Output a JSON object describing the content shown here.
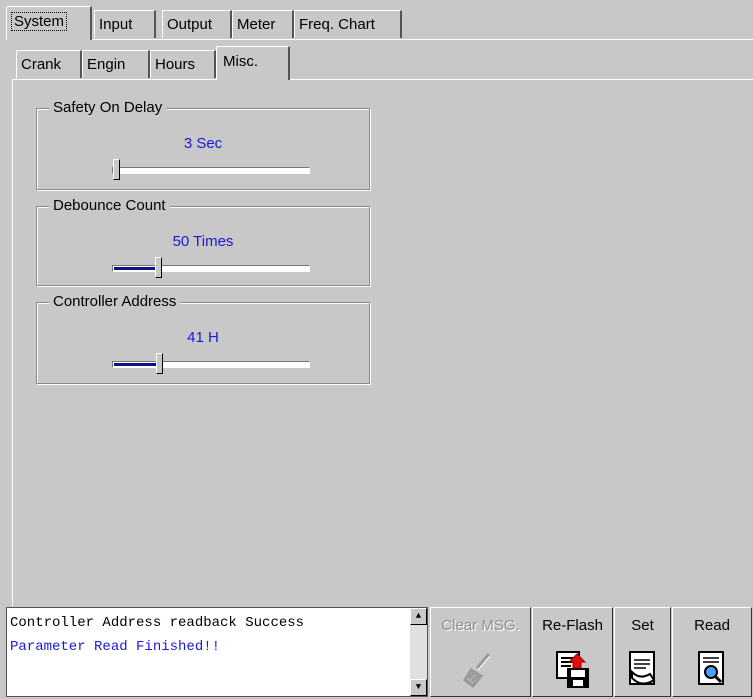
{
  "tabs_top": [
    {
      "label": "System"
    },
    {
      "label": "Input"
    },
    {
      "label": "Output"
    },
    {
      "label": "Meter"
    },
    {
      "label": "Freq. Chart"
    }
  ],
  "tabs_sub": [
    {
      "label": "Crank"
    },
    {
      "label": "Engin"
    },
    {
      "label": "Hours"
    },
    {
      "label": "Misc."
    }
  ],
  "groups": [
    {
      "title": "Safety On Delay",
      "value": "3 Sec",
      "slider_fraction": 0.0
    },
    {
      "title": "Debounce Count",
      "value": "50 Times",
      "slider_fraction": 0.22
    },
    {
      "title": "Controller Address",
      "value": "41 H",
      "slider_fraction": 0.23
    }
  ],
  "messages": {
    "line1": "Controller Address readback Success",
    "line2": "Parameter Read Finished!!"
  },
  "toolbar": {
    "clear_label": "Clear MSG.",
    "reflash_label": "Re-Flash",
    "set_label": "Set",
    "read_label": "Read"
  },
  "colors": {
    "value_text": "#1a1ad8",
    "slider_fill": "#101080",
    "background": "#c8c8c8"
  }
}
